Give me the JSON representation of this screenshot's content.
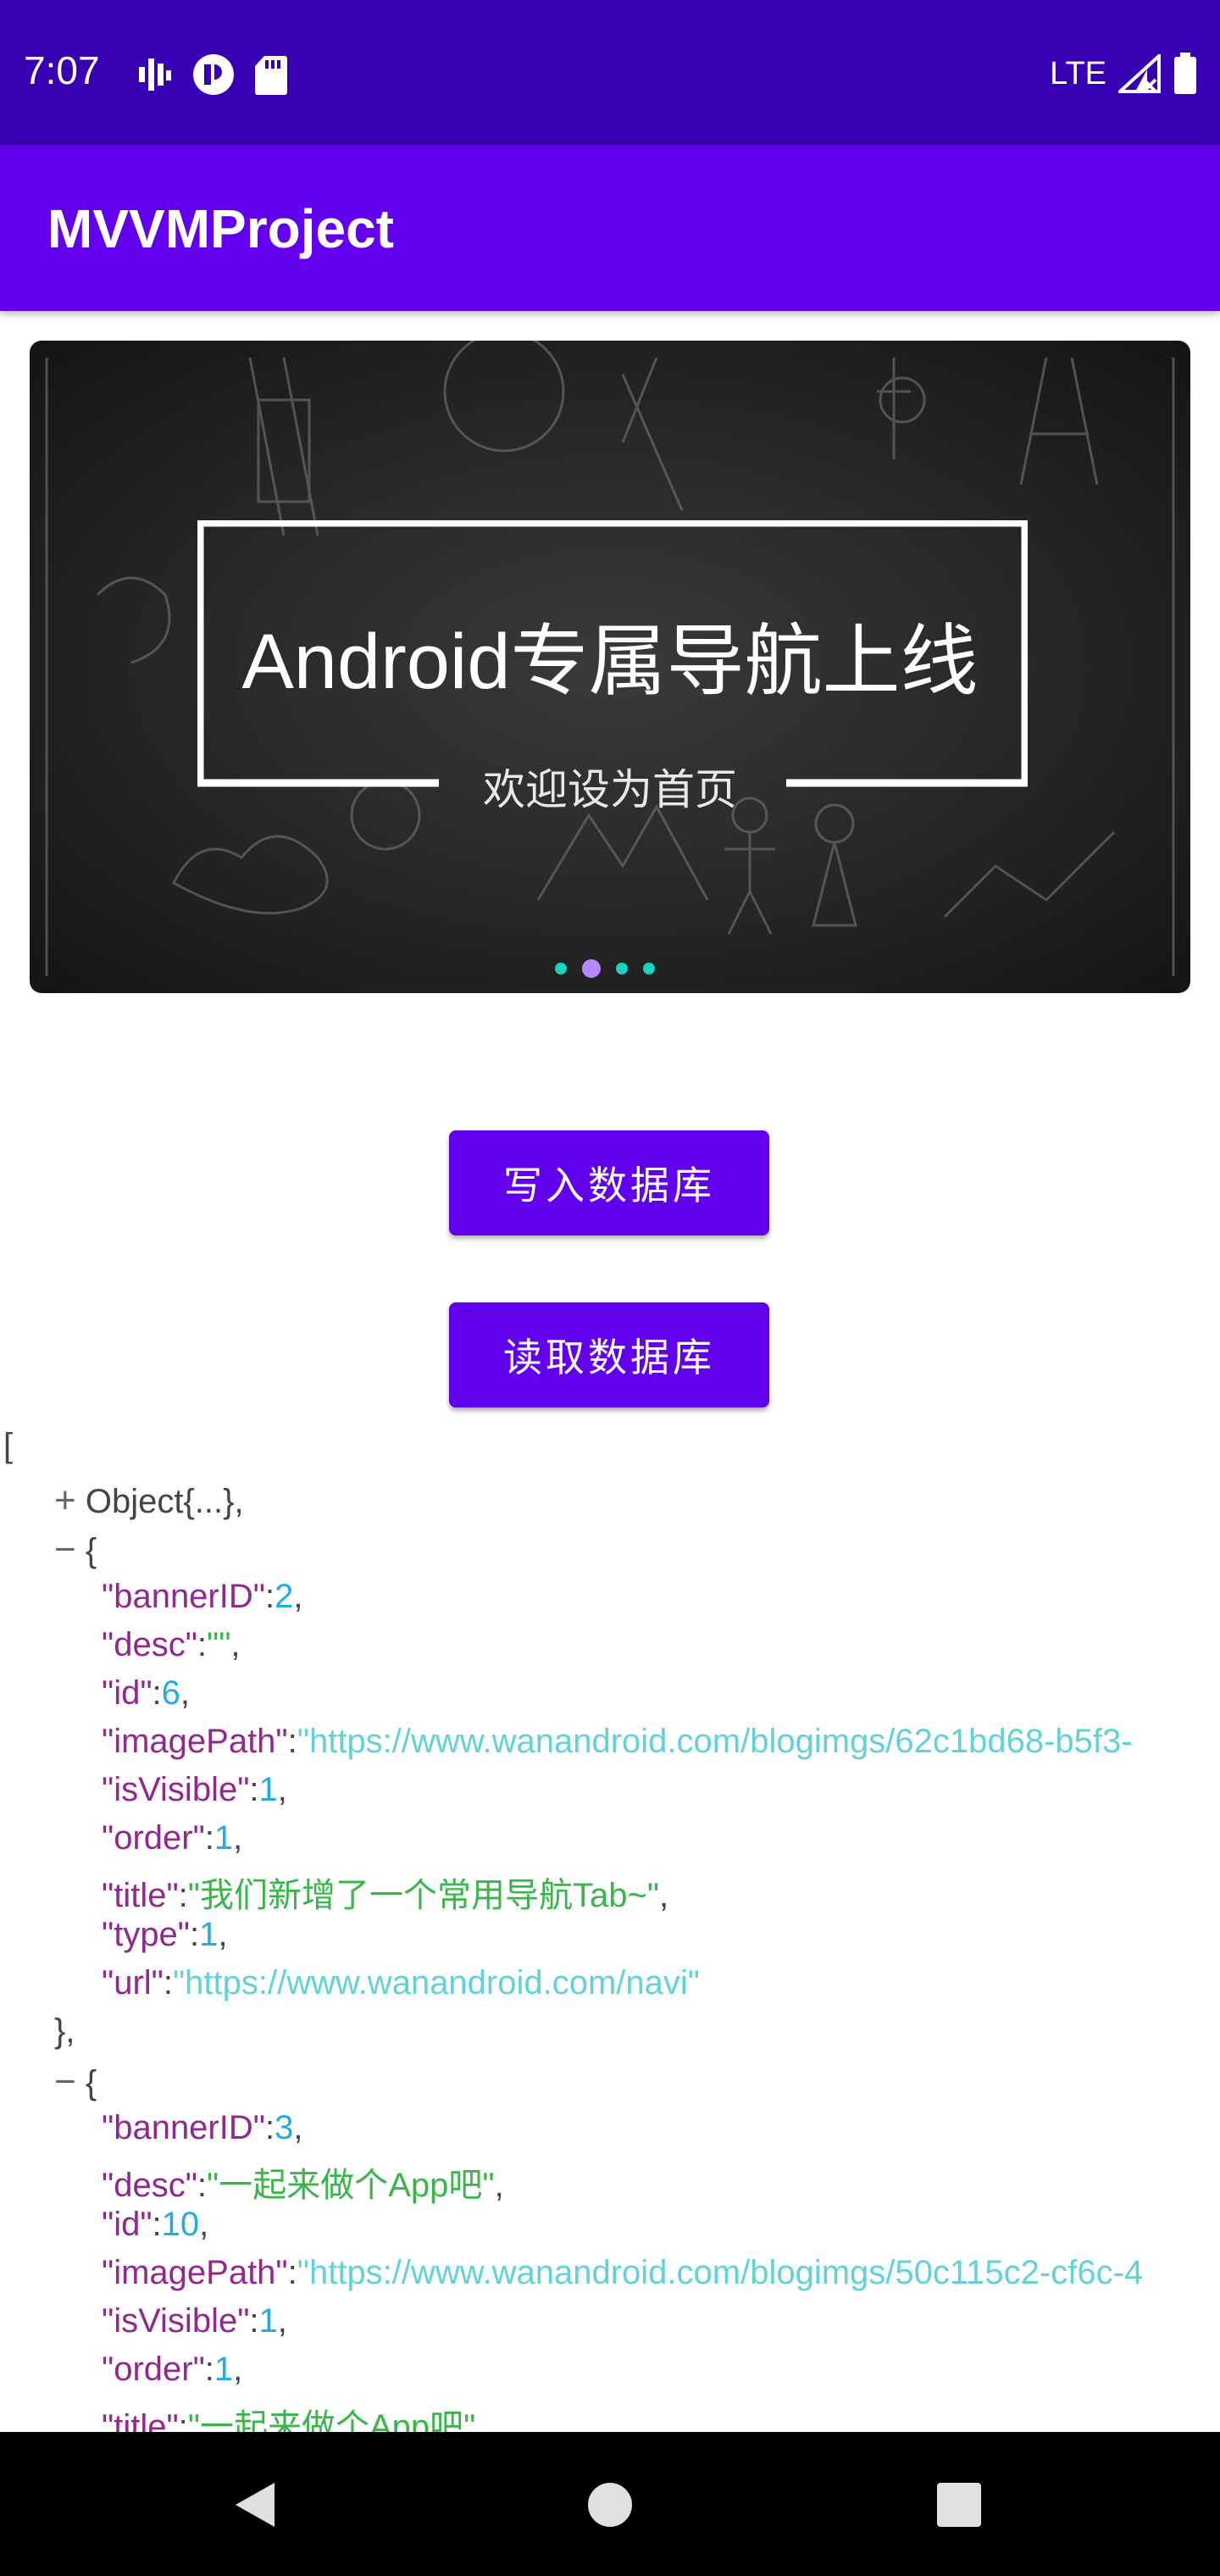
{
  "status_bar": {
    "time": "7:07",
    "left_icons": [
      "signal-bars-icon",
      "notification-icon",
      "sd-card-icon"
    ],
    "network": "LTE",
    "right_icons": [
      "signal-icon",
      "battery-icon"
    ]
  },
  "app_bar": {
    "title": "MVVMProject"
  },
  "banner": {
    "title": "Android专属导航上线",
    "subtitle": "欢迎设为首页",
    "page_count": 4,
    "active_index": 1
  },
  "buttons": {
    "write": "写入数据库",
    "read": "读取数据库"
  },
  "json_view": {
    "open_bracket": "[",
    "collapsed_label": "Object{...},",
    "collapsed_toggle": "+",
    "expanded_toggle": "−",
    "open_brace": "{",
    "close_brace": "},",
    "items": [
      {
        "bannerID": "2",
        "desc": "\"\"",
        "id": "6",
        "imagePath": "\"https://www.wanandroid.com/blogimgs/62c1bd68-b5f3-",
        "isVisible": "1",
        "order": "1",
        "title": "\"我们新增了一个常用导航Tab~\"",
        "type": "1",
        "url": "\"https://www.wanandroid.com/navi\""
      },
      {
        "bannerID": "3",
        "desc": "\"一起来做个App吧\"",
        "id": "10",
        "imagePath": "\"https://www.wanandroid.com/blogimgs/50c115c2-cf6c-4",
        "isVisible": "1",
        "order": "1",
        "title": "\"一起来做个App吧\","
      }
    ]
  },
  "colors": {
    "status_bar": "#3700b3",
    "primary": "#6200ee",
    "json_key": "#92278f",
    "json_number": "#25aae1",
    "json_string": "#3ab54a",
    "json_url": "#61d2d6",
    "indicator": "#1bd1c0",
    "indicator_active": "#b887ff"
  },
  "nav_bar": {
    "icons": [
      "back-icon",
      "home-icon",
      "recents-icon"
    ]
  }
}
